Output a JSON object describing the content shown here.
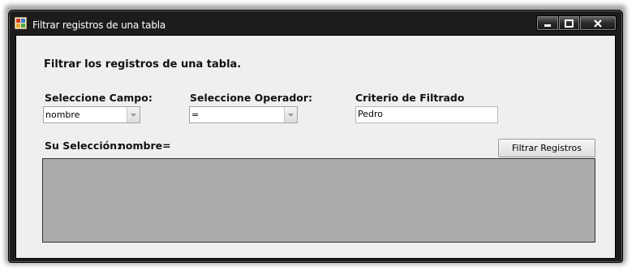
{
  "window": {
    "title": "Filtrar registros de una tabla",
    "controls": {
      "minimize": "minimize-icon",
      "maximize": "maximize-icon",
      "close": "close-icon"
    }
  },
  "form": {
    "heading": "Filtrar los registros de una tabla.",
    "campo_label": "Seleccione Campo:",
    "campo_value": "nombre",
    "operador_label": "Seleccione Operador:",
    "operador_value": "=",
    "criterio_label": "Criterio de Filtrado",
    "criterio_value": "Pedro",
    "seleccion_label": "Su Selección:",
    "seleccion_value": "nombre=",
    "filter_button": "Filtrar Registros"
  },
  "colors": {
    "client_bg": "#efefed",
    "grid_bg": "#ababab",
    "titlebar": "#1c1c1c"
  }
}
